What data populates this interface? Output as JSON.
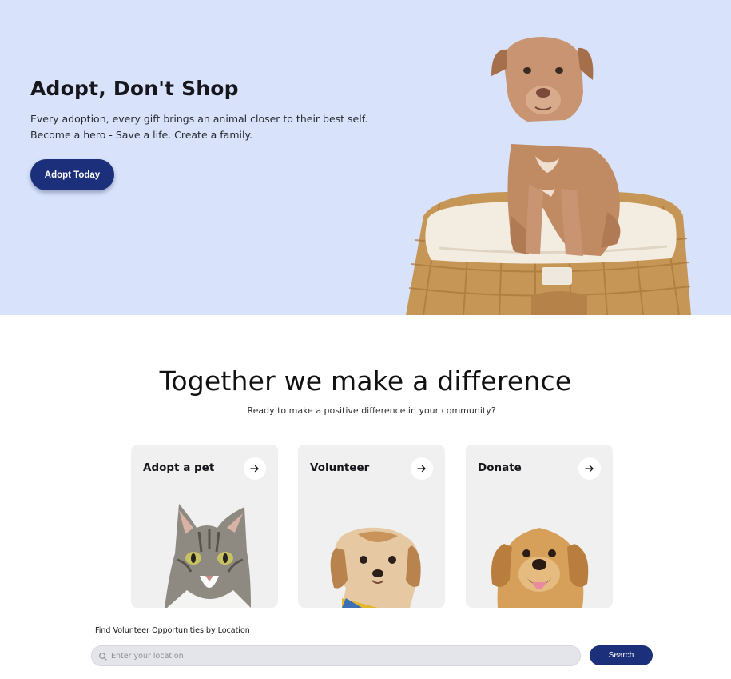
{
  "hero": {
    "title": "Adopt, Don't Shop",
    "text": "Every adoption, every gift brings an animal closer to their best self. Become a hero - Save a life. Create a family.",
    "button": "Adopt Today"
  },
  "section": {
    "title": "Together we make a difference",
    "subtitle": "Ready to make a positive difference in your community?"
  },
  "cards": [
    {
      "label": "Adopt a pet",
      "icon": "arrow-right-icon",
      "image": "tabby-cat"
    },
    {
      "label": "Volunteer",
      "icon": "arrow-right-icon",
      "image": "shih-tzu-puppy"
    },
    {
      "label": "Donate",
      "icon": "arrow-right-icon",
      "image": "golden-retriever"
    }
  ],
  "search": {
    "label": "Find Volunteer Opportunities by Location",
    "placeholder": "Enter your location",
    "value": "",
    "button": "Search"
  },
  "colors": {
    "hero_bg": "#d8e3fb",
    "primary": "#1c2f7a",
    "card_bg": "#f0f0f0"
  }
}
